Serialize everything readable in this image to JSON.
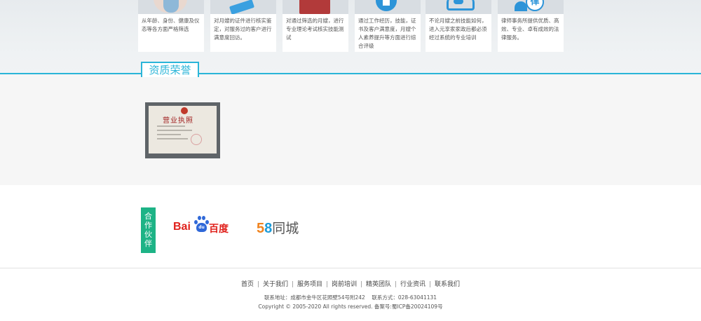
{
  "cards": [
    {
      "icon": "nanny-person-photo",
      "text": "从年龄、身份、健康及仪态等各方面严格筛选"
    },
    {
      "icon": "certificate-badge-photo",
      "text": "对月嫂的证件进行核实鉴定，对服务过的客户进行满意度回访。"
    },
    {
      "icon": "red-book-photo",
      "text": "对通过筛选的月嫂，进行专业理论考试核实技能测试"
    },
    {
      "icon": "check-circle-icon",
      "text": "通过工作经历，技能，证书及客户满意度，月嫂个人素养提升等方面进行综合评级"
    },
    {
      "icon": "team-people-icon",
      "text": "不论月嫂之前技能如何，进入元享家家政后都必须经过系统的专业培训"
    },
    {
      "icon": "law-icon",
      "icon_text": "律",
      "text": "律师事务所提供优质、高效、专业、卓有成效的法律服务。"
    }
  ],
  "honor": {
    "title": "资质荣誉",
    "license_title": "营业执照"
  },
  "partners": {
    "label_chars": [
      "合",
      "作",
      "伙",
      "伴"
    ],
    "baidu": {
      "bai": "Bai",
      "du_paw": "du",
      "du_cn": "百度"
    },
    "tongcheng": {
      "five": "5",
      "eight": "8",
      "name": "同城"
    }
  },
  "footer": {
    "nav": [
      "首页",
      "关于我们",
      "服务项目",
      "岗前培训",
      "精英团队",
      "行业资讯",
      "联系我们"
    ],
    "address": "联系地址：成都市金牛区花照壁54号附242",
    "phone": "联系方式：028-63041131",
    "copyright": "Copyright © 2005-2020 All rights reserved. 备案号:蜀ICP备20024109号"
  },
  "colors": {
    "accent": "#2bb5d8",
    "partner_green": "#1db386",
    "baidu_red": "#e0211c",
    "baidu_blue": "#2f68d8"
  }
}
